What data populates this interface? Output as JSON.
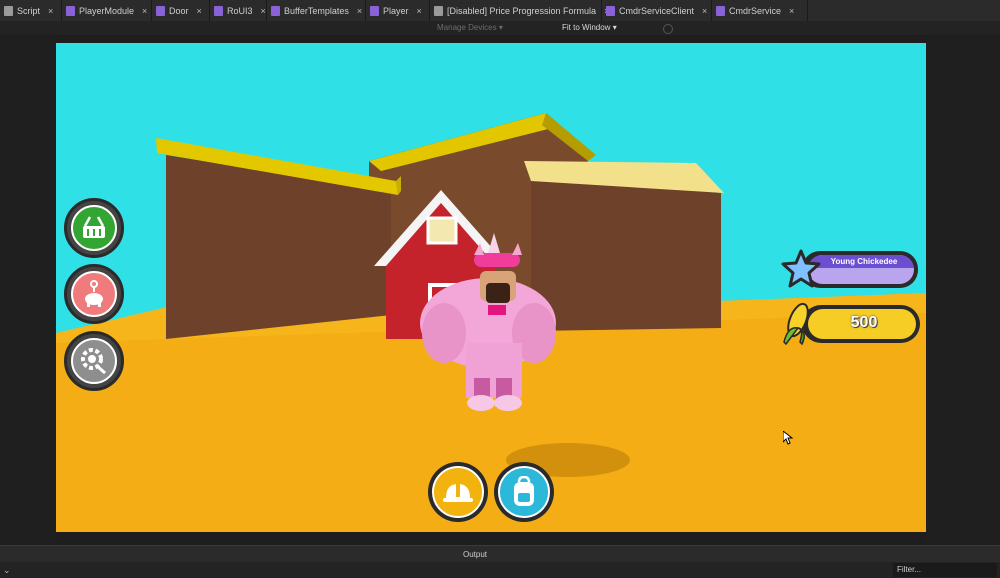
{
  "tabs": [
    {
      "label": "Script",
      "icon": "script-icon"
    },
    {
      "label": "PlayerModule",
      "icon": "module-script-icon"
    },
    {
      "label": "Door",
      "icon": "module-script-icon"
    },
    {
      "label": "RoUI3",
      "icon": "module-script-icon"
    },
    {
      "label": "BufferTemplates",
      "icon": "module-script-icon"
    },
    {
      "label": "Player",
      "icon": "module-script-icon"
    },
    {
      "label": "[Disabled] Price Progression Formula",
      "icon": "script-icon"
    },
    {
      "label": "CmdrServiceClient",
      "icon": "module-script-icon"
    },
    {
      "label": "CmdrService",
      "icon": "module-script-icon"
    }
  ],
  "tab_close_glyph": "×",
  "device_bar": {
    "manage_devices": "Manage Devices",
    "fit_label": "Fit to Window"
  },
  "game_hud": {
    "rank_label": "Young Chickedee",
    "currency_value": "500",
    "side_buttons": [
      "shop-basket-icon",
      "pet-elephant-icon",
      "settings-gear-icon"
    ],
    "bottom_buttons": [
      "hard-hat-icon",
      "backpack-icon"
    ]
  },
  "output_label": "Output",
  "filter_placeholder": "Filter..."
}
